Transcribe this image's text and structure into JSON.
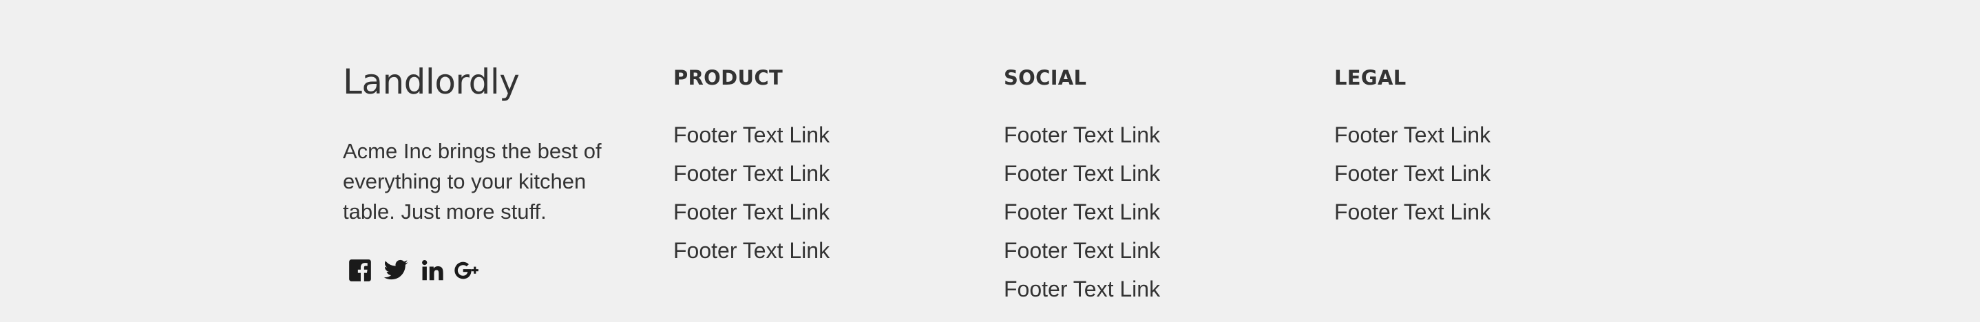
{
  "brand": {
    "name": "Landlordly",
    "tagline": "Acme Inc brings the best of everything to your kitchen table. Just more stuff."
  },
  "social_icons": [
    {
      "icon": "facebook-icon",
      "label": "Facebook"
    },
    {
      "icon": "twitter-icon",
      "label": "Twitter"
    },
    {
      "icon": "linkedin-icon",
      "label": "LinkedIn"
    },
    {
      "icon": "google-plus-icon",
      "label": "Google Plus"
    }
  ],
  "columns": [
    {
      "heading": "PRODUCT",
      "links": [
        "Footer Text Link",
        "Footer Text Link",
        "Footer Text Link",
        "Footer Text Link"
      ]
    },
    {
      "heading": "SOCIAL",
      "links": [
        "Footer Text Link",
        "Footer Text Link",
        "Footer Text Link",
        "Footer Text Link",
        "Footer Text Link"
      ]
    },
    {
      "heading": "LEGAL",
      "links": [
        "Footer Text Link",
        "Footer Text Link",
        "Footer Text Link"
      ]
    }
  ],
  "colors": {
    "background": "#f0f0f0",
    "text": "#333333",
    "icon": "#1a1a1a"
  }
}
